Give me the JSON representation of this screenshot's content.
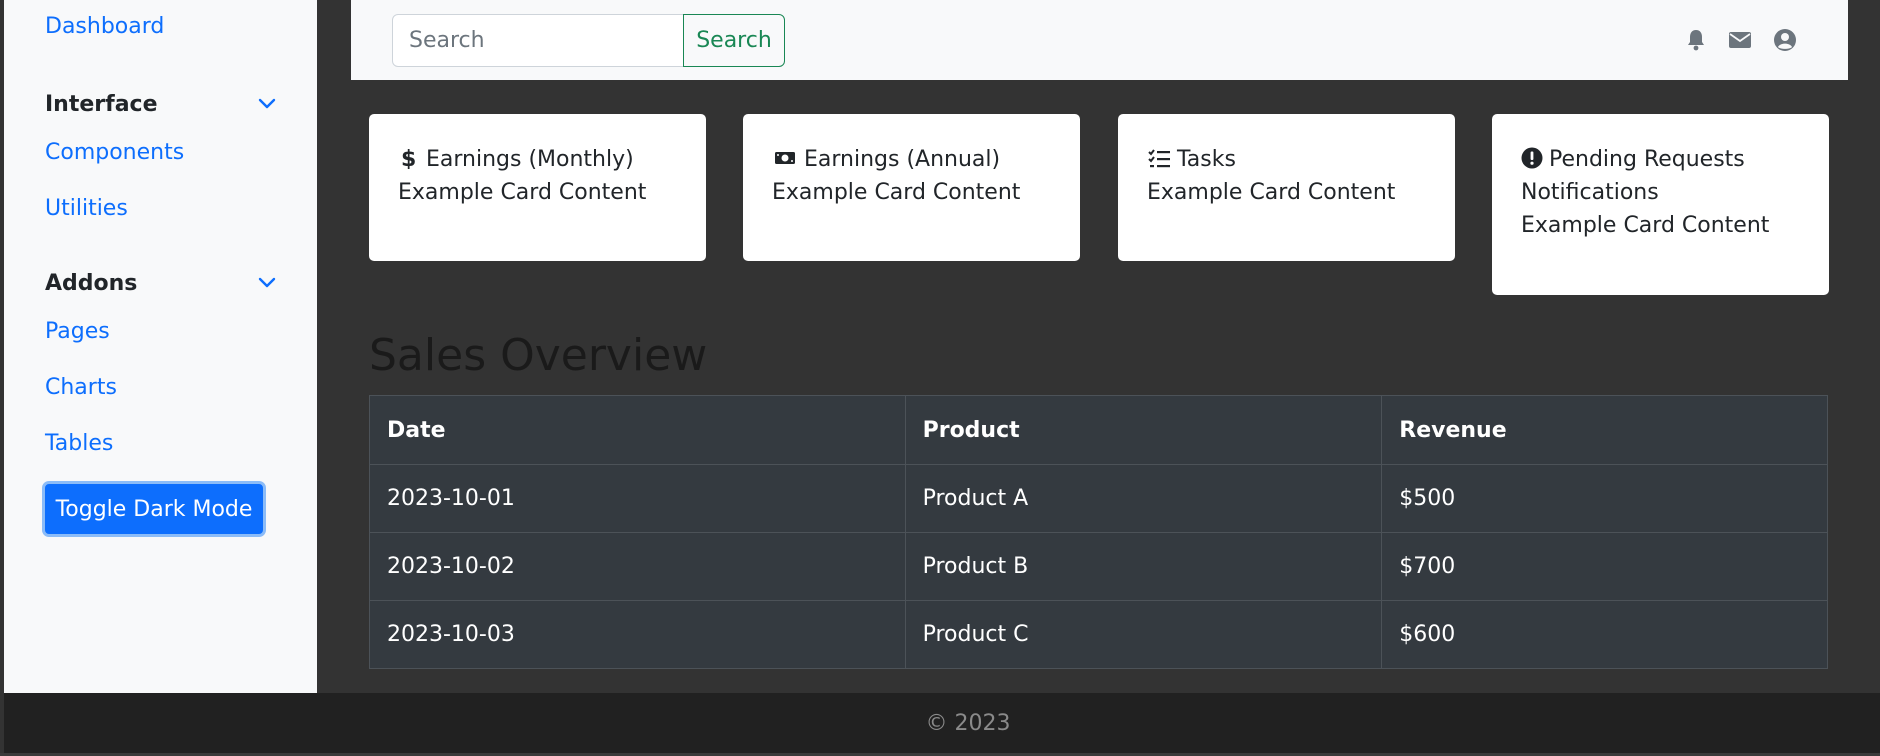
{
  "sidebar": {
    "dashboard": "Dashboard",
    "interface_heading": "Interface",
    "components": "Components",
    "utilities": "Utilities",
    "addons_heading": "Addons",
    "pages": "Pages",
    "charts": "Charts",
    "tables": "Tables",
    "toggle_dark_mode": "Toggle Dark Mode"
  },
  "topbar": {
    "search_placeholder": "Search",
    "search_button": "Search",
    "icons": [
      "bell-icon",
      "envelope-icon",
      "user-circle-icon"
    ]
  },
  "cards": [
    {
      "icon": "dollar-icon",
      "title": "Earnings (Monthly)",
      "content": "Example Card Content"
    },
    {
      "icon": "cash-icon",
      "title": "Earnings (Annual)",
      "content": "Example Card Content"
    },
    {
      "icon": "checklist-icon",
      "title": "Tasks",
      "content": "Example Card Content"
    },
    {
      "icon": "exclamation-circle-icon",
      "title": "Pending Requests",
      "subtitle": "Notifications",
      "content": "Example Card Content"
    }
  ],
  "sales": {
    "title": "Sales Overview",
    "headers": [
      "Date",
      "Product",
      "Revenue"
    ],
    "rows": [
      [
        "2023-10-01",
        "Product A",
        "$500"
      ],
      [
        "2023-10-02",
        "Product B",
        "$700"
      ],
      [
        "2023-10-03",
        "Product C",
        "$600"
      ]
    ]
  },
  "footer": {
    "text": "© 2023"
  },
  "colors": {
    "link": "#0d6efd",
    "success": "#198754",
    "table_bg": "#343a40",
    "page_bg": "#333333"
  }
}
